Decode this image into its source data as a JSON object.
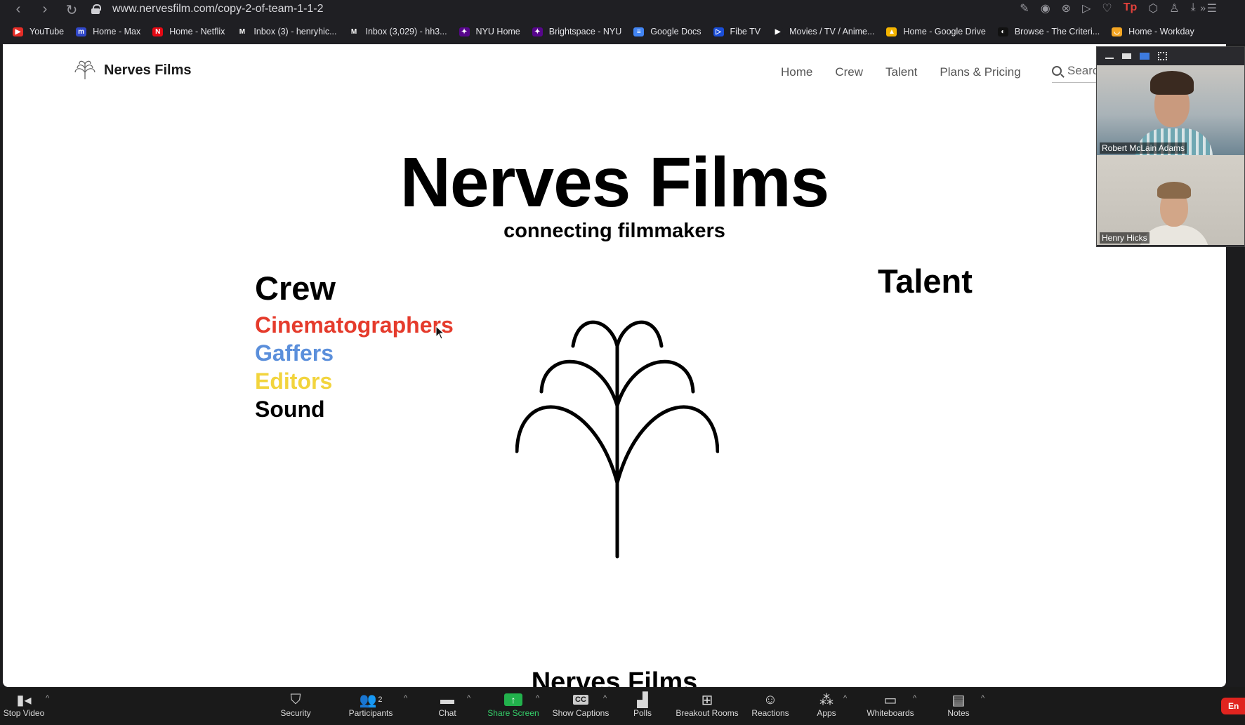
{
  "browser": {
    "url": "www.nervesfilm.com/copy-2-of-team-1-1-2",
    "bookmarks": [
      {
        "label": "YouTube",
        "color": "#e52d27",
        "glyph": "▶"
      },
      {
        "label": "Home - Max",
        "color": "#3047c9",
        "glyph": "m"
      },
      {
        "label": "Home - Netflix",
        "color": "#e50914",
        "glyph": "N"
      },
      {
        "label": "Inbox (3) - henryhic...",
        "color": "#1f1f23",
        "glyph": "M"
      },
      {
        "label": "Inbox (3,029) - hh3...",
        "color": "#1f1f23",
        "glyph": "M"
      },
      {
        "label": "NYU Home",
        "color": "#57068c",
        "glyph": "✦"
      },
      {
        "label": "Brightspace - NYU",
        "color": "#57068c",
        "glyph": "✦"
      },
      {
        "label": "Google Docs",
        "color": "#4285f4",
        "glyph": "≡"
      },
      {
        "label": "Fibe TV",
        "color": "#1a4ed8",
        "glyph": "▷"
      },
      {
        "label": "Movies / TV / Anime...",
        "color": "#1f1f23",
        "glyph": "▶"
      },
      {
        "label": "Home - Google Drive",
        "color": "#f4b400",
        "glyph": "▲"
      },
      {
        "label": "Browse - The Criteri...",
        "color": "#111111",
        "glyph": "◐"
      },
      {
        "label": "Home - Workday",
        "color": "#f5a623",
        "glyph": "◡"
      }
    ]
  },
  "site": {
    "logo_text": "Nerves Films",
    "nav": [
      "Home",
      "Crew",
      "Talent",
      "Plans & Pricing"
    ],
    "search_placeholder": "Searc",
    "hero_title": "Nerves Films",
    "hero_subtitle": "connecting filmmakers",
    "crew_heading": "Crew",
    "crew_items": [
      {
        "label": "Cinematographers",
        "color": "#e53b2c"
      },
      {
        "label": "Gaffers",
        "color": "#5b8fdb"
      },
      {
        "label": "Editors",
        "color": "#f2d43d"
      },
      {
        "label": "Sound",
        "color": "#000000"
      }
    ],
    "talent_heading": "Talent",
    "footer_peek": "Nerves Films"
  },
  "video_panel": {
    "participants": [
      {
        "name": "Robert McLain Adams"
      },
      {
        "name": "Henry Hicks"
      }
    ]
  },
  "zoom_toolbar": {
    "stop_video": "Stop Video",
    "security": "Security",
    "participants": "Participants",
    "participants_count": "2",
    "chat": "Chat",
    "share_screen": "Share Screen",
    "show_captions": "Show Captions",
    "polls": "Polls",
    "breakout_rooms": "Breakout Rooms",
    "reactions": "Reactions",
    "apps": "Apps",
    "whiteboards": "Whiteboards",
    "notes": "Notes",
    "end": "En",
    "captions_badge": "CC"
  }
}
